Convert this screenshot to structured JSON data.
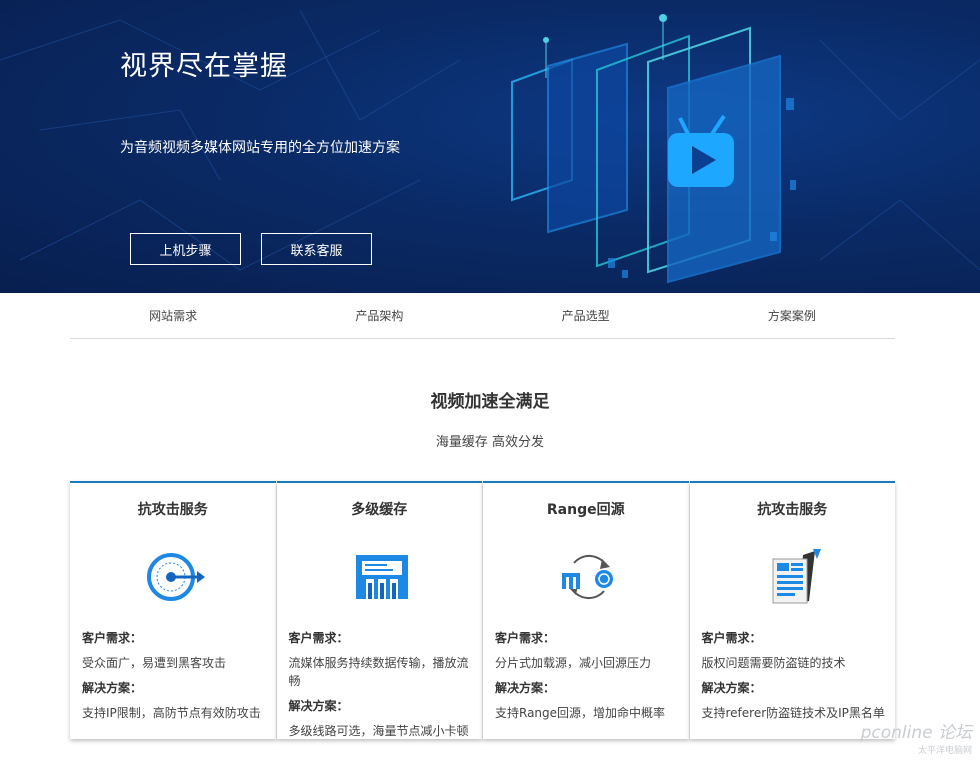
{
  "hero": {
    "title": "视界尽在掌握",
    "subtitle": "为音频视频多媒体网站专用的全方位加速方案",
    "buttons": [
      "上机步骤",
      "联系客服"
    ]
  },
  "tabs": [
    "网站需求",
    "产品架构",
    "产品选型",
    "方案案例"
  ],
  "section": {
    "title": "视频加速全满足",
    "subtitle": "海量缓存 高效分发"
  },
  "cards": [
    {
      "title": "抗攻击服务",
      "icon": "target-icon",
      "req_label": "客户需求：",
      "req": "受众面广，易遭到黑客攻击",
      "sol_label": "解决方案：",
      "sol": "支持IP限制，高防节点有效防攻击"
    },
    {
      "title": "多级缓存",
      "icon": "cache-server-icon",
      "req_label": "客户需求：",
      "req": "流媒体服务持续数据传输，播放流畅",
      "sol_label": "解决方案：",
      "sol": "多级线路可选，海量节点减小卡顿"
    },
    {
      "title": "Range回源",
      "icon": "range-origin-icon",
      "req_label": "客户需求：",
      "req": "分片式加载源，减小回源压力",
      "sol_label": "解决方案：",
      "sol": "支持Range回源，增加命中概率"
    },
    {
      "title": "抗攻击服务",
      "icon": "anti-hotlink-icon",
      "req_label": "客户需求：",
      "req": "版权问题需要防盗链的技术",
      "sol_label": "解决方案：",
      "sol": "支持referer防盗链技术及IP黑名单"
    }
  ],
  "watermark": {
    "brand": "pconline 论坛",
    "sub": "太平洋电脑网"
  },
  "colors": {
    "hero_bg": "#0a2a66",
    "accent": "#1a7bbf",
    "icon_blue": "#1e88e5"
  }
}
